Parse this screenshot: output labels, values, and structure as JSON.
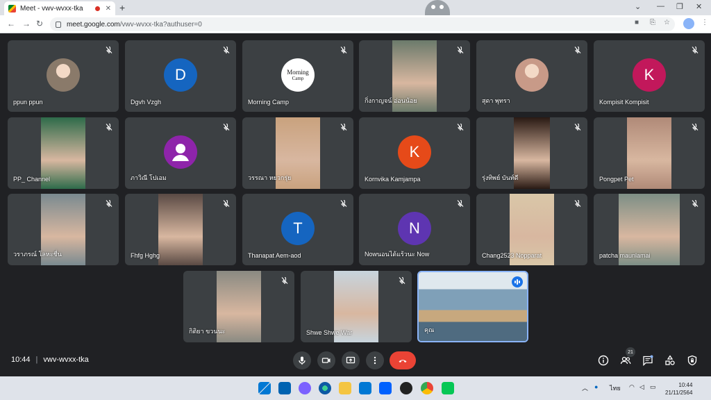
{
  "browser": {
    "tab_title": "Meet - vwv-wvxx-tka",
    "tab_close": "✕",
    "new_tab": "+",
    "url_domain": "meet.google.com",
    "url_path": "/vwv-wvxx-tka?authuser=0"
  },
  "participants": [
    {
      "name": "ppun ppun",
      "kind": "photo",
      "color": "#8a7a6a"
    },
    {
      "name": "Dgvh Vzgh",
      "kind": "letter",
      "letter": "D",
      "color": "#1565c0"
    },
    {
      "name": "Morning Camp",
      "kind": "logo",
      "logo_top": "Morning",
      "logo_bottom": "Camp",
      "color": "#ffffff"
    },
    {
      "name": "กิ่งกาญจน์ อ่อนน้อย",
      "kind": "video",
      "color": "#6b7a6b"
    },
    {
      "name": "สุดา พุทรา",
      "kind": "photo",
      "color": "#c89a88"
    },
    {
      "name": "Kompisit Kompisit",
      "kind": "letter",
      "letter": "K",
      "color": "#c2185b"
    },
    {
      "name": "PP_ Channel",
      "kind": "video",
      "color": "#2e6b4a"
    },
    {
      "name": "ภาวิณี โปเอม",
      "kind": "person",
      "color": "#8e24aa"
    },
    {
      "name": "วรรณา หยวกรุ่ย",
      "kind": "video",
      "color": "#c9a27e"
    },
    {
      "name": "Kornvika Kamjampa",
      "kind": "letter",
      "letter": "K",
      "color": "#e64a19"
    },
    {
      "name": "รุ่งทิพย์ บันท์ดี",
      "kind": "video",
      "color": "#2a1a14"
    },
    {
      "name": "Pongpet Pet",
      "kind": "video",
      "color": "#b08a78"
    },
    {
      "name": "วราภรณ์ โลหะชื่น",
      "kind": "video",
      "color": "#7a8a90"
    },
    {
      "name": "Fhfg Hghg",
      "kind": "video",
      "color": "#5a4a44"
    },
    {
      "name": "Thanapat Aem-aod",
      "kind": "letter",
      "letter": "T",
      "color": "#1565c0"
    },
    {
      "name": "Nowนอนได้แร้วนะ Now",
      "kind": "letter",
      "letter": "N",
      "color": "#5e35b1"
    },
    {
      "name": "Chang2523 Nopparat",
      "kind": "video",
      "color": "#d9c7a8"
    },
    {
      "name": "patcha maunlamai",
      "kind": "video",
      "color": "#7d8f86"
    },
    {
      "name": "กิติยา ขวนนะ",
      "kind": "video",
      "color": "#8a8a82"
    },
    {
      "name": "Shwe Shwe War",
      "kind": "video",
      "color": "#c7d4dd"
    },
    {
      "name": "คุณ",
      "kind": "self",
      "color": "#6f8fa3"
    }
  ],
  "bottom": {
    "time": "10:44",
    "separator": "|",
    "meeting_code": "vwv-wvxx-tka",
    "people_count": "21"
  },
  "taskbar": {
    "lang": "ไทย",
    "clock_time": "10:44",
    "clock_date": "21/11/2564"
  }
}
